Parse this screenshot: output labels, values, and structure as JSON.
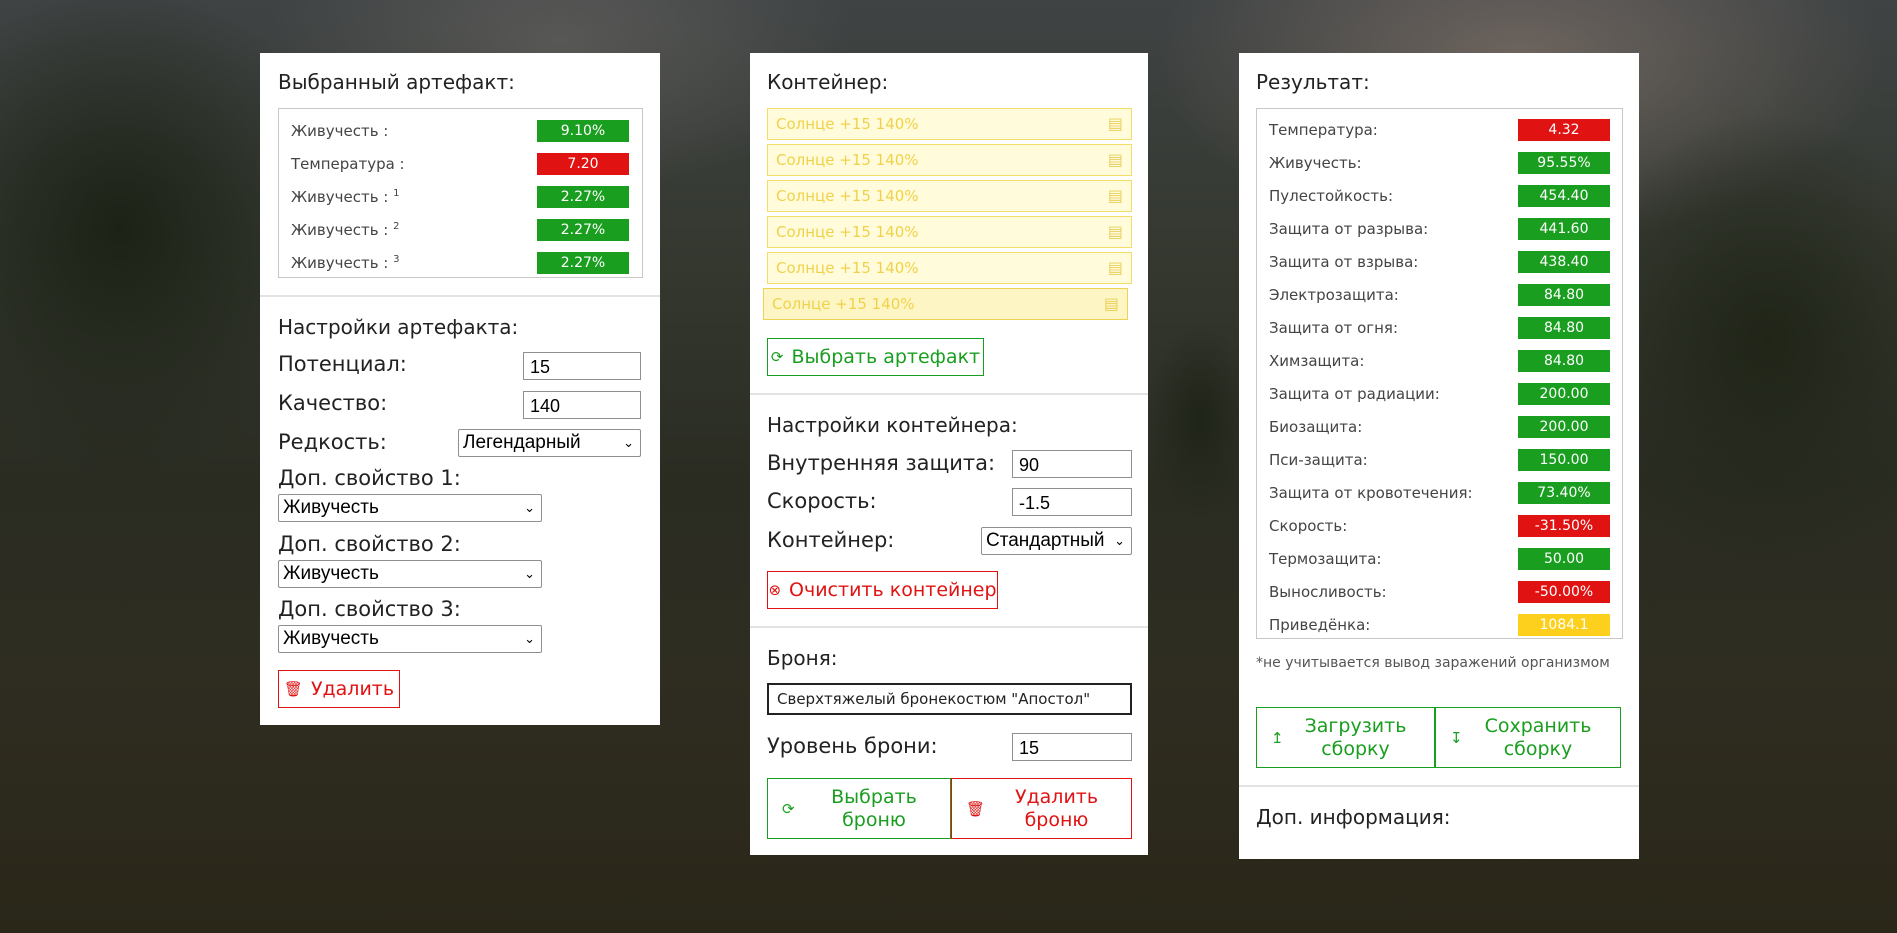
{
  "selected_artifact": {
    "title": "Выбранный артефакт:",
    "stats": [
      {
        "label": "Живучесть :",
        "sup": "",
        "value": "9.10%",
        "color": "green"
      },
      {
        "label": "Температура :",
        "sup": "",
        "value": "7.20",
        "color": "red"
      },
      {
        "label": "Живучесть :",
        "sup": "1",
        "value": "2.27%",
        "color": "green"
      },
      {
        "label": "Живучесть :",
        "sup": "2",
        "value": "2.27%",
        "color": "green"
      },
      {
        "label": "Живучесть :",
        "sup": "3",
        "value": "2.27%",
        "color": "green"
      }
    ]
  },
  "artifact_settings": {
    "title": "Настройки артефакта:",
    "potential_label": "Потенциал:",
    "potential_value": "15",
    "quality_label": "Качество:",
    "quality_value": "140",
    "rarity_label": "Редкость:",
    "rarity_value": "Легендарный",
    "extra1_label": "Доп. свойство 1:",
    "extra1_value": "Живучесть",
    "extra2_label": "Доп. свойство 2:",
    "extra2_value": "Живучесть",
    "extra3_label": "Доп. свойство 3:",
    "extra3_value": "Живучесть",
    "delete_label": "Удалить"
  },
  "container": {
    "title": "Контейнер:",
    "slots": [
      "Солнце +15 140%",
      "Солнце +15 140%",
      "Солнце +15 140%",
      "Солнце +15 140%",
      "Солнце +15 140%",
      "Солнце +15 140%"
    ],
    "choose_label": "Выбрать артефакт"
  },
  "container_settings": {
    "title": "Настройки контейнера:",
    "inner_label": "Внутренняя защита:",
    "inner_value": "90",
    "speed_label": "Скорость:",
    "speed_value": "-1.5",
    "type_label": "Контейнер:",
    "type_value": "Стандартный",
    "clear_label": "Очистить контейнер"
  },
  "armor": {
    "title": "Броня:",
    "name": "Сверхтяжелый бронекостюм \"Апостол\"",
    "level_label": "Уровень брони:",
    "level_value": "15",
    "choose_label": "Выбрать броню",
    "delete_label": "Удалить броню"
  },
  "result": {
    "title": "Результат:",
    "stats": [
      {
        "label": "Температура:",
        "value": "4.32",
        "color": "red"
      },
      {
        "label": "Живучесть:",
        "value": "95.55%",
        "color": "green"
      },
      {
        "label": "Пулестойкость:",
        "value": "454.40",
        "color": "green"
      },
      {
        "label": "Защита от разрыва:",
        "value": "441.60",
        "color": "green"
      },
      {
        "label": "Защита от взрыва:",
        "value": "438.40",
        "color": "green"
      },
      {
        "label": "Электрозащита:",
        "value": "84.80",
        "color": "green"
      },
      {
        "label": "Защита от огня:",
        "value": "84.80",
        "color": "green"
      },
      {
        "label": "Химзащита:",
        "value": "84.80",
        "color": "green"
      },
      {
        "label": "Защита от радиации:",
        "value": "200.00",
        "color": "green"
      },
      {
        "label": "Биозащита:",
        "value": "200.00",
        "color": "green"
      },
      {
        "label": "Пси-защита:",
        "value": "150.00",
        "color": "green"
      },
      {
        "label": "Защита от кровотечения:",
        "value": "73.40%",
        "color": "green"
      },
      {
        "label": "Скорость:",
        "value": "-31.50%",
        "color": "red"
      },
      {
        "label": "Термозащита:",
        "value": "50.00",
        "color": "green"
      },
      {
        "label": "Выносливость:",
        "value": "-50.00%",
        "color": "red"
      },
      {
        "label": "Приведёнка:",
        "value": "1084.1",
        "color": "yellow"
      }
    ],
    "note": "*не учитывается вывод заражений организмом",
    "load_label": "Загрузить сборку",
    "save_label": "Сохранить сборку",
    "extra_info_title": "Доп. информация:"
  },
  "colors": {
    "green": "#1a9e1f",
    "red": "#e01212",
    "yellow": "#fcd01c"
  },
  "icons": {
    "refresh": "refresh-icon",
    "trash": "trash-icon",
    "clear": "clear-circle-icon",
    "upload": "upload-icon",
    "download": "download-icon",
    "document": "document-icon"
  }
}
